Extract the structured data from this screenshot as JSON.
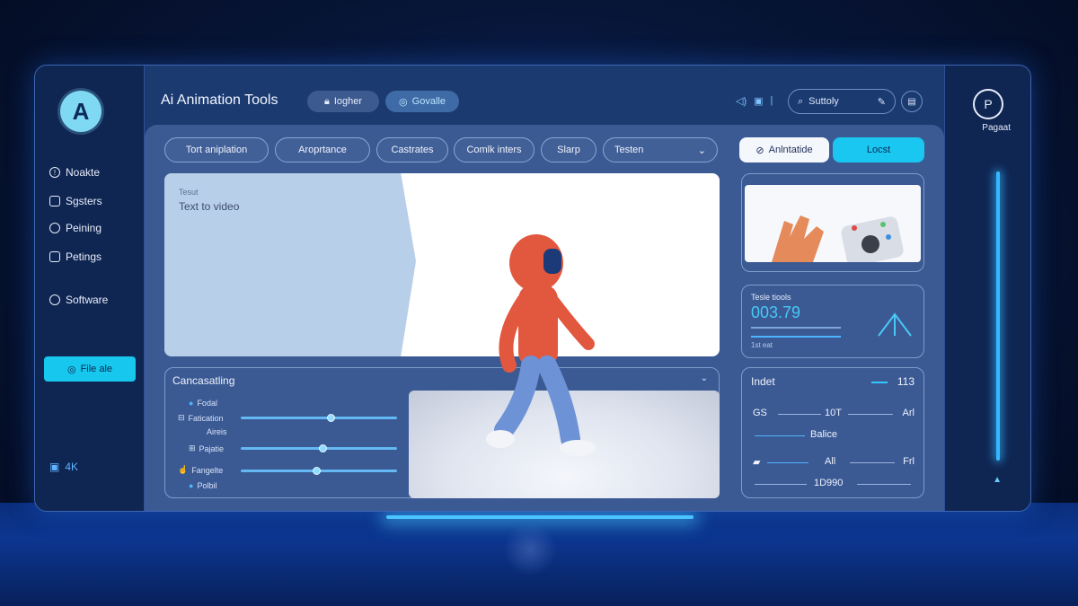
{
  "app": {
    "title": "Ai Animation Tools",
    "logo_letter": "A"
  },
  "top_pills": [
    {
      "label": "Iogher",
      "icon": "lock-icon"
    },
    {
      "label": "Govalle",
      "icon": "circle-icon"
    }
  ],
  "search": {
    "value": "Suttoly",
    "icon": "search-icon"
  },
  "sidebar": {
    "items": [
      {
        "label": "Noakte",
        "icon": "info-icon"
      },
      {
        "label": "Sgsters",
        "icon": "grid-icon"
      },
      {
        "label": "Peining",
        "icon": "palette-icon"
      },
      {
        "label": "Petings",
        "icon": "settings-icon"
      },
      {
        "label": "Software",
        "icon": "clock-icon"
      }
    ],
    "file_button": "File ale",
    "resolution": "4K"
  },
  "toolbar": {
    "chips": [
      "Tort aniplation",
      "Aroprtance",
      "Castrates",
      "Comlk inters",
      "Slarp"
    ],
    "dropdown": "Testen",
    "btn_white": "Anlntatide",
    "btn_cyan": "Locst"
  },
  "preview": {
    "small": "Tesut",
    "label": "Text to video"
  },
  "controls": {
    "title": "Cancasatling",
    "rows": [
      {
        "label": "Fodal",
        "value": null
      },
      {
        "label": "Fatication",
        "value": 0.55
      },
      {
        "label": "Aireis",
        "value": null
      },
      {
        "label": "Pajatie",
        "value": 0.5
      },
      {
        "label": "Fangelte",
        "value": 0.46
      },
      {
        "label": "Polbil",
        "value": null
      }
    ]
  },
  "stats": {
    "title": "Tesle tiools",
    "value": "003.79",
    "sub": "1st eat"
  },
  "info": {
    "title": "Indet",
    "number": "113",
    "row1": [
      "GS",
      "10T",
      "Arl"
    ],
    "balance": "Balice",
    "row3": [
      "All",
      "Frl"
    ],
    "footer": "1D990"
  },
  "right_rail": {
    "label": "Pagaat"
  },
  "colors": {
    "accent": "#19c7f0",
    "panel": "#3b5a94",
    "rail": "#0f2552"
  }
}
